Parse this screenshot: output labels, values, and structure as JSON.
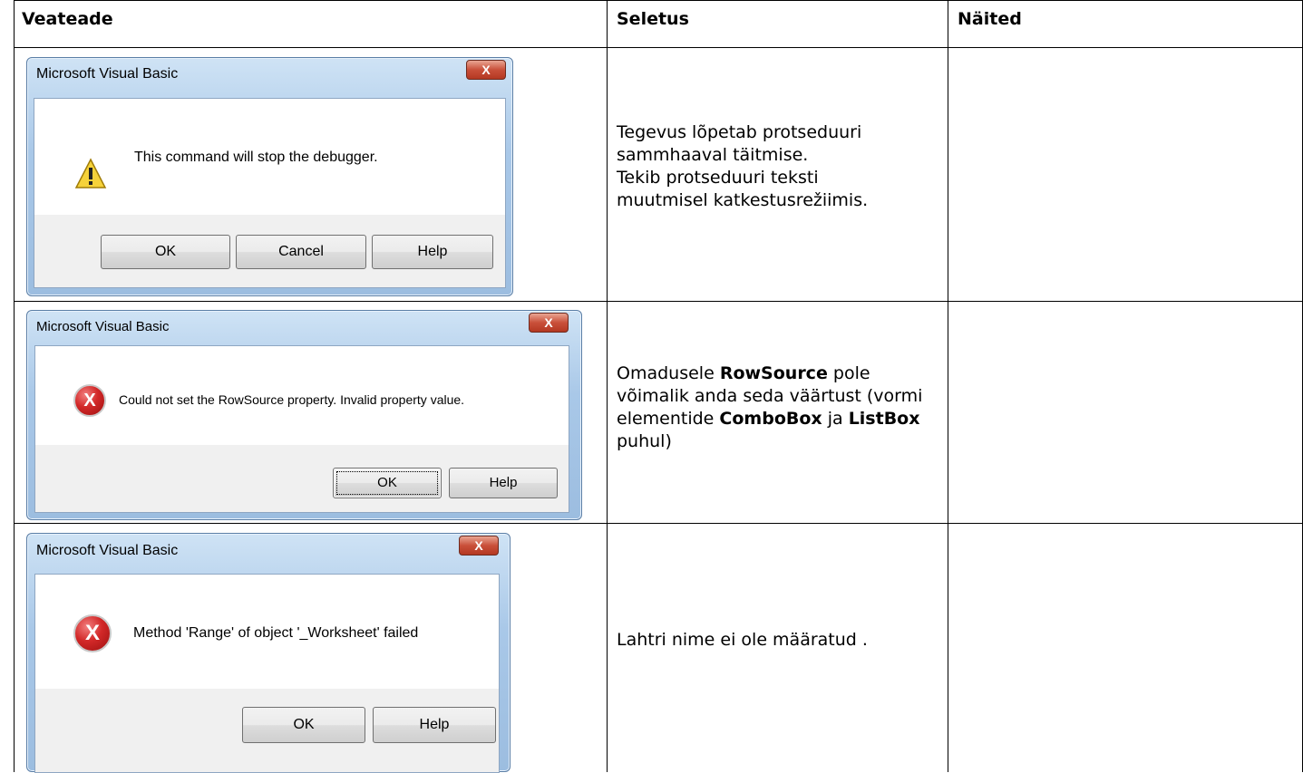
{
  "table": {
    "headers": [
      "Veateade",
      "Seletus",
      "Näited"
    ]
  },
  "rows": [
    {
      "dialog": {
        "title": "Microsoft Visual Basic",
        "icon": "warning-icon",
        "message": "This command will stop the debugger.",
        "buttons": [
          "OK",
          "Cancel",
          "Help"
        ]
      },
      "explanation_lines": [
        "Tegevus lõpetab protseduuri",
        "sammhaaval täitmise.",
        "Tekib protseduuri teksti",
        "muutmisel katkestusrežiimis."
      ]
    },
    {
      "dialog": {
        "title": "Microsoft Visual Basic",
        "icon": "error-icon",
        "message": "Could not set the RowSource property. Invalid property value.",
        "buttons": [
          "OK",
          "Help"
        ]
      },
      "explanation_parts": [
        {
          "text": "Omadusele ",
          "bold": false
        },
        {
          "text": "RowSource",
          "bold": true
        },
        {
          "text": " pole võimalik anda seda väärtust (vormi elementide ",
          "bold": false
        },
        {
          "text": "ComboBox",
          "bold": true
        },
        {
          "text": " ja ",
          "bold": false
        },
        {
          "text": "ListBox",
          "bold": true
        },
        {
          "text": " puhul)",
          "bold": false
        }
      ]
    },
    {
      "dialog": {
        "title": "Microsoft Visual Basic",
        "icon": "error-icon",
        "message": "Method 'Range' of object '_Worksheet' failed",
        "buttons": [
          "OK",
          "Help"
        ]
      },
      "explanation": "Lahtri nime ei ole määratud ."
    }
  ],
  "close_glyph": "X"
}
